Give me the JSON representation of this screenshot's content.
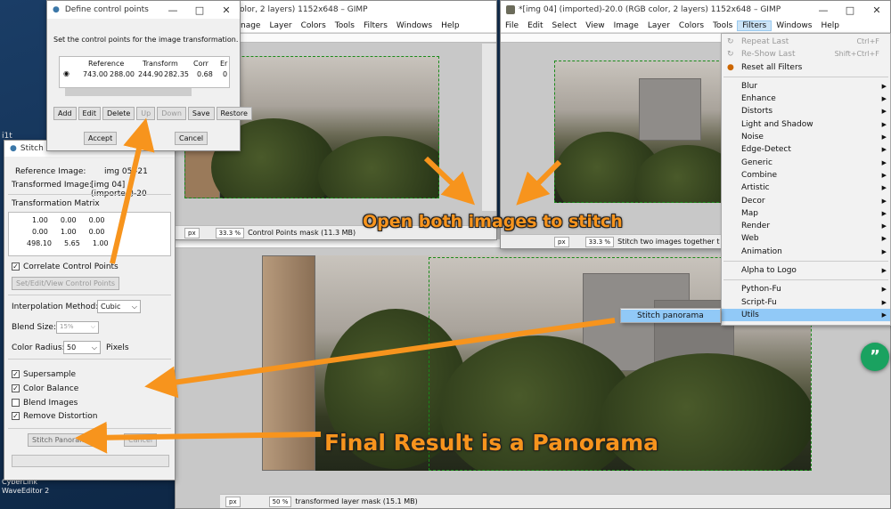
{
  "desktop": {
    "label_top": "i1t",
    "label_bottom1": "CyberLink",
    "label_bottom2": "WaveEditor 2"
  },
  "gimp_left": {
    "title": "olor, 2 layers) 1152x648 – GIMP",
    "menu": [
      "nage",
      "Layer",
      "Colors",
      "Tools",
      "Filters",
      "Windows",
      "Help"
    ],
    "status": {
      "unit": "px",
      "zoom": "33.3 %",
      "message": "Control Points mask (11.3 MB)"
    }
  },
  "gimp_right": {
    "title": "*[img 04] (imported)-20.0 (RGB color, 2 layers) 1152x648 – GIMP",
    "menu": [
      "File",
      "Edit",
      "Select",
      "View",
      "Image",
      "Layer",
      "Colors",
      "Tools",
      "Filters",
      "Windows",
      "Help"
    ],
    "status": {
      "unit": "px",
      "zoom": "33.3 %",
      "message": "Stitch two images together t"
    }
  },
  "gimp_main": {
    "status": {
      "unit": "px",
      "zoom": "50 %",
      "message": "transformed layer mask (15.1 MB)"
    }
  },
  "filters_menu": {
    "repeat_last": "Repeat Last",
    "repeat_sc": "Ctrl+F",
    "reshow_last": "Re-Show Last",
    "reshow_sc": "Shift+Ctrl+F",
    "reset_all": "Reset all Filters",
    "items": [
      "Blur",
      "Enhance",
      "Distorts",
      "Light and Shadow",
      "Noise",
      "Edge-Detect",
      "Generic",
      "Combine",
      "Artistic",
      "Decor",
      "Map",
      "Render",
      "Web",
      "Animation"
    ],
    "alpha_to_logo": "Alpha to Logo",
    "python_fu": "Python-Fu",
    "script_fu": "Script-Fu",
    "utils": "Utils",
    "submenu_item": "Stitch panorama"
  },
  "control_points": {
    "title": "Define control points",
    "instructions": "Set the control points for the image transformation.",
    "headers": [
      "Reference",
      "Transform",
      "Corr",
      "Er"
    ],
    "row": [
      "743.00",
      "288.00",
      "244.90",
      "282.35",
      "0.68",
      "0"
    ],
    "buttons": [
      "Add",
      "Edit",
      "Delete",
      "Up",
      "Down",
      "Save",
      "Restore"
    ],
    "accept": "Accept",
    "cancel": "Cancel"
  },
  "stitch": {
    "title": "Stitch",
    "ref_label": "Reference Image:",
    "ref_value": "img 05 -21",
    "trans_label": "Transformed Image:",
    "trans_value": "[img 04] (imported)-20",
    "matrix_label": "Transformation Matrix",
    "matrix": [
      [
        "1.00",
        "0.00",
        "0.00"
      ],
      [
        "0.00",
        "1.00",
        "0.00"
      ],
      [
        "498.10",
        "5.65",
        "1.00"
      ]
    ],
    "correlate": "Correlate Control Points",
    "set_edit_btn": "Set/Edit/View Control Points",
    "interp_label": "Interpolation Method:",
    "interp_value": "Cubic",
    "blend_label": "Blend Size:",
    "blend_value": "15%",
    "radius_label": "Color Radius:",
    "radius_value": "50",
    "radius_unit": "Pixels",
    "options": [
      {
        "label": "Supersample",
        "checked": true
      },
      {
        "label": "Color Balance",
        "checked": true
      },
      {
        "label": "Blend Images",
        "checked": false
      },
      {
        "label": "Remove Distortion",
        "checked": true
      }
    ],
    "stitch_btn": "Stitch Panorama",
    "cancel_btn": "Cancel"
  },
  "callouts": {
    "open": "Open both images to stitch",
    "final": "Final Result is a Panorama"
  },
  "accent": "#f7941d",
  "fab_icon": "quote-icon"
}
